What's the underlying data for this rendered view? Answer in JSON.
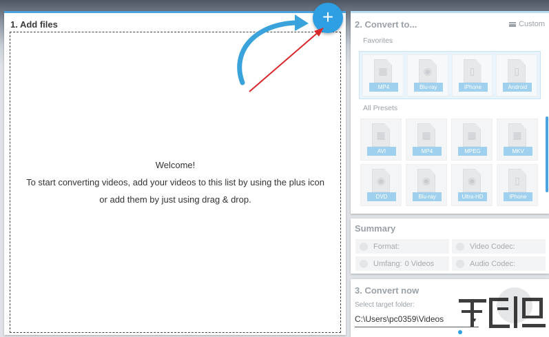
{
  "add_files": {
    "title": "1. Add files",
    "welcome_title": "Welcome!",
    "welcome_line1": "To start converting videos, add your videos to this list by using the plus icon",
    "welcome_line2": "or add them by just using drag & drop.",
    "add_button_glyph": "+"
  },
  "convert_to": {
    "title": "2. Convert to...",
    "custom_label": "Custom",
    "favorites_label": "Favorites",
    "favorites": [
      {
        "label": "MP4",
        "icon": "film-icon"
      },
      {
        "label": "Blu-ray",
        "icon": "disc-icon"
      },
      {
        "label": "iPhone",
        "icon": "phone-icon"
      },
      {
        "label": "Android",
        "icon": "android-icon"
      }
    ],
    "all_presets_label": "All Presets",
    "presets": [
      {
        "label": "AVI",
        "icon": "film-icon"
      },
      {
        "label": "MP4",
        "icon": "film-icon"
      },
      {
        "label": "MPEG",
        "icon": "film-icon"
      },
      {
        "label": "MKV",
        "icon": "film-icon"
      },
      {
        "label": "DVD",
        "icon": "disc-icon"
      },
      {
        "label": "Blu-ray",
        "icon": "disc-icon"
      },
      {
        "label": "Ultra-HD",
        "icon": "disc-icon"
      },
      {
        "label": "iPhone",
        "icon": "phone-icon"
      }
    ]
  },
  "summary": {
    "title": "Summary",
    "format_label": "Format:",
    "video_codec_label": "Video Codec:",
    "umfang_label": "Umfang:",
    "umfang_value": "0 Videos",
    "audio_codec_label": "Audio Codec:"
  },
  "convert_now": {
    "title": "3. Convert now",
    "target_folder_label": "Select target folder:",
    "target_folder_value": "C:\\Users\\pc0359\\Videos"
  },
  "colors": {
    "accent": "#2f9fe3",
    "annotation_arrow_red": "#d8262b",
    "annotation_arrow_blue": "#3aa3dc"
  }
}
